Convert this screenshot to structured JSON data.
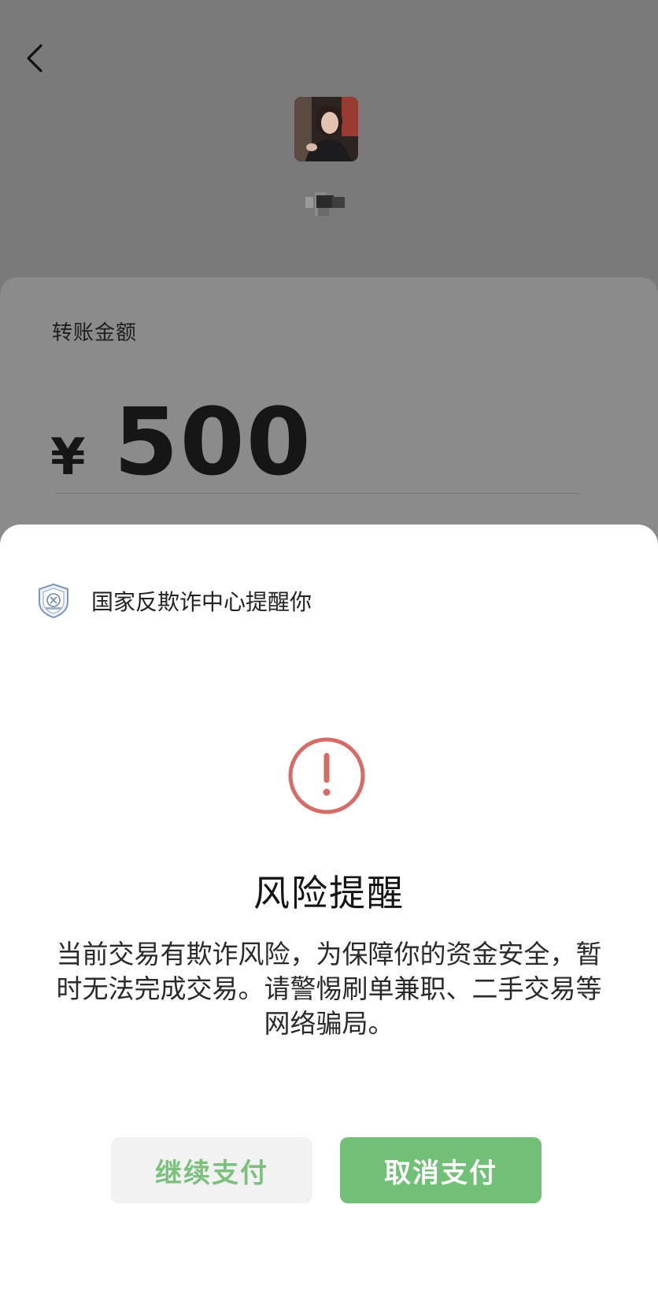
{
  "header": {
    "back_icon": "chevron-left-icon"
  },
  "transfer": {
    "amount_label": "转账金额",
    "currency_symbol": "¥",
    "amount": "500"
  },
  "risk_sheet": {
    "source_icon": "anti-fraud-shield-icon",
    "source_text": "国家反欺诈中心提醒你",
    "alert_icon": "exclamation-circle-icon",
    "title": "风险提醒",
    "message": "当前交易有欺诈风险，为保障你的资金安全，暂时无法完成交易。请警惕刷单兼职、二手交易等网络骗局。",
    "continue_label": "继续支付",
    "cancel_label": "取消支付"
  },
  "colors": {
    "overlay": "#7a7a7a",
    "alert_red": "#d76b66",
    "primary_green": "#72c077",
    "continue_text_green": "#7cc07e"
  }
}
